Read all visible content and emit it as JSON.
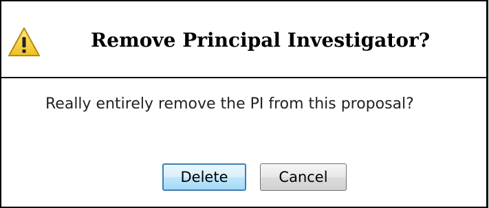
{
  "dialog": {
    "title": "Remove Principal Investigator?",
    "message": "Really entirely remove the PI from this proposal?",
    "icon": "warning-icon",
    "buttons": {
      "delete_label": "Delete",
      "cancel_label": "Cancel"
    },
    "colors": {
      "warning_fill": "#f5d44a",
      "primary_button_border": "#3c7fb1"
    }
  }
}
